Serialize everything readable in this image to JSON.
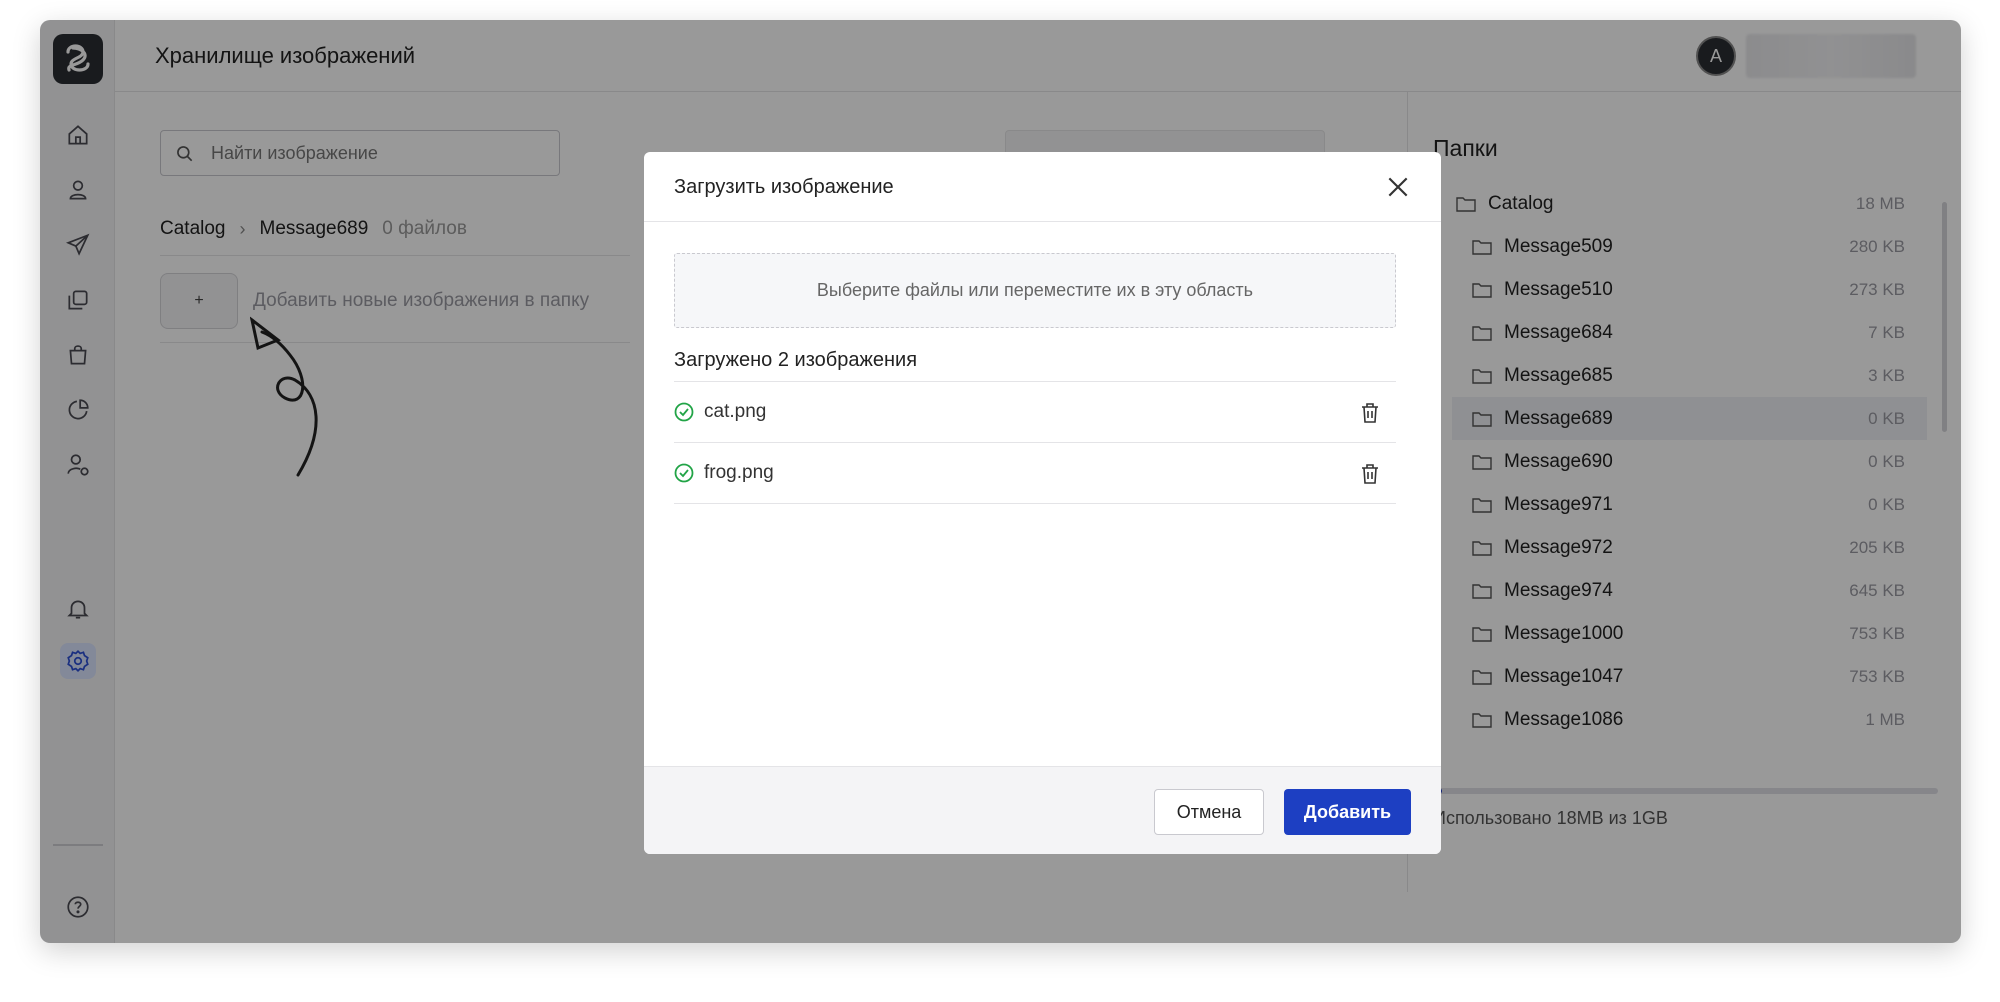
{
  "header": {
    "title": "Хранилище изображений",
    "avatar_letter": "A"
  },
  "search": {
    "placeholder": "Найти изображение"
  },
  "breadcrumb": {
    "root": "Catalog",
    "current": "Message689",
    "count": "0 файлов"
  },
  "add": {
    "button_label": "+",
    "hint": "Добавить новые изображения в папку"
  },
  "sidebar": {
    "items": [
      {
        "icon": "home-icon"
      },
      {
        "icon": "user-icon"
      },
      {
        "icon": "send-icon"
      },
      {
        "icon": "copy-icon"
      },
      {
        "icon": "bag-icon"
      },
      {
        "icon": "pie-chart-icon"
      },
      {
        "icon": "user-settings-icon"
      },
      {
        "icon": "bell-icon"
      },
      {
        "icon": "gear-icon",
        "active": true
      },
      {
        "icon": "help-icon"
      }
    ]
  },
  "folders": {
    "title": "Папки",
    "items": [
      {
        "name": "Catalog",
        "size": "18 MB",
        "root": true
      },
      {
        "name": "Message509",
        "size": "280 KB"
      },
      {
        "name": "Message510",
        "size": "273 KB"
      },
      {
        "name": "Message684",
        "size": "7 KB"
      },
      {
        "name": "Message685",
        "size": "3 KB"
      },
      {
        "name": "Message689",
        "size": "0 KB",
        "selected": true
      },
      {
        "name": "Message690",
        "size": "0 KB"
      },
      {
        "name": "Message971",
        "size": "0 KB"
      },
      {
        "name": "Message972",
        "size": "205 KB"
      },
      {
        "name": "Message974",
        "size": "645 KB"
      },
      {
        "name": "Message1000",
        "size": "753 KB"
      },
      {
        "name": "Message1047",
        "size": "753 KB"
      },
      {
        "name": "Message1086",
        "size": "1 MB"
      }
    ],
    "usage_text": "Использовано 18MB из 1GB",
    "usage_fraction": 0.018
  },
  "modal": {
    "title": "Загрузить изображение",
    "dropzone_text": "Выберите файлы или переместите их в эту область",
    "uploaded_title": "Загружено 2 изображения",
    "files": [
      {
        "name": "cat.png"
      },
      {
        "name": "frog.png"
      }
    ],
    "cancel_label": "Отмена",
    "add_label": "Добавить"
  },
  "colors": {
    "accent": "#1d3fc2",
    "success": "#22a447",
    "sidebar_bg": "#f4f4f5"
  }
}
